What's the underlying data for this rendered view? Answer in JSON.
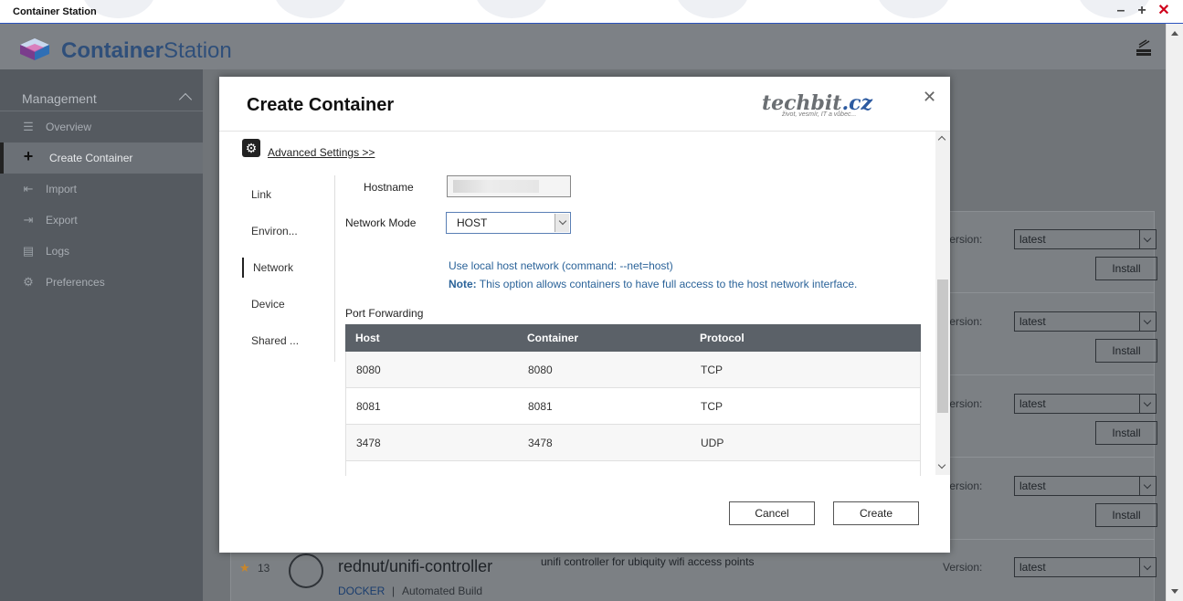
{
  "window": {
    "title": "Container Station"
  },
  "app": {
    "brand_bold": "Container",
    "brand_light": "Station"
  },
  "sidebar": {
    "section": "Management",
    "items": [
      {
        "label": "Overview",
        "icon": "list-icon"
      },
      {
        "label": "Create Container",
        "icon": "plus-icon"
      },
      {
        "label": "Import",
        "icon": "import-icon"
      },
      {
        "label": "Export",
        "icon": "export-icon"
      },
      {
        "label": "Logs",
        "icon": "logs-icon"
      },
      {
        "label": "Preferences",
        "icon": "gear-icon"
      }
    ]
  },
  "background_list": {
    "version_label": "Version:",
    "version_value": "latest",
    "install_label": "Install",
    "bottom_item": {
      "stars": "13",
      "name": "rednut/unifi-controller",
      "description": "unifi controller for ubiquity wifi access points",
      "tag": "DOCKER",
      "separator": "|",
      "build": "Automated Build"
    }
  },
  "modal": {
    "title": "Create Container",
    "watermark": {
      "name": "techbit",
      "tld": ".cz",
      "tagline": "život, vesmír, IT a vůbec..."
    },
    "advanced_link": "Advanced Settings >>",
    "tabs": [
      "Link",
      "Environ...",
      "Network",
      "Device",
      "Shared ..."
    ],
    "active_tab": "Network",
    "hostname_label": "Hostname",
    "network_mode_label": "Network Mode",
    "network_mode_value": "HOST",
    "info_line1": "Use local host network (command: --net=host)",
    "info_note_prefix": "Note:",
    "info_note_text": " This option allows containers to have full access to the host network interface.",
    "port_forwarding": {
      "title": "Port Forwarding",
      "columns": [
        "Host",
        "Container",
        "Protocol"
      ],
      "rows": [
        [
          "8080",
          "8080",
          "TCP"
        ],
        [
          "8081",
          "8081",
          "TCP"
        ],
        [
          "3478",
          "3478",
          "UDP"
        ]
      ]
    },
    "cancel_label": "Cancel",
    "create_label": "Create"
  }
}
